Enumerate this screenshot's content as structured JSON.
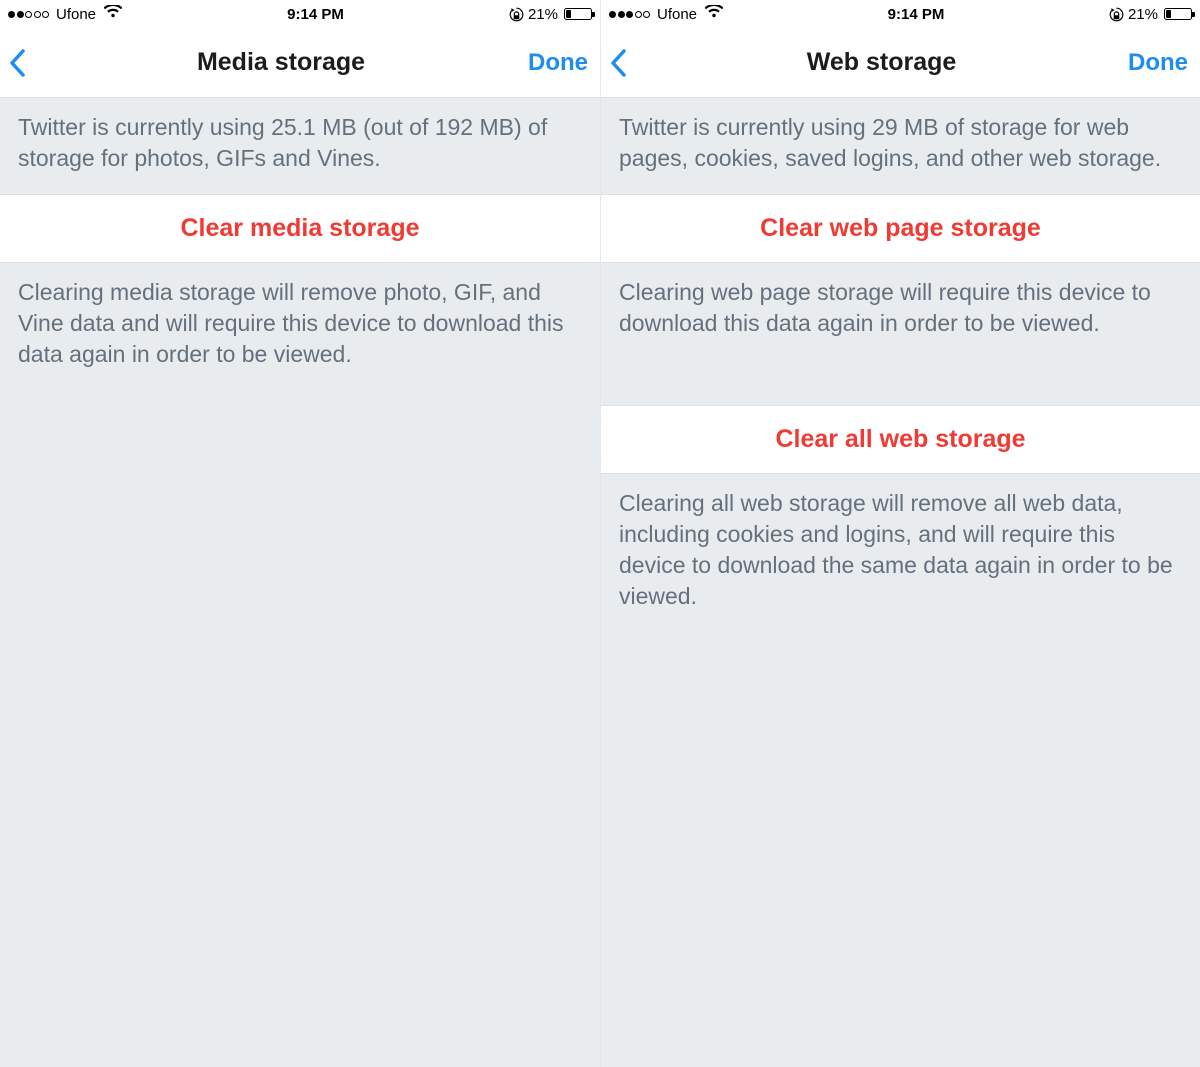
{
  "statusbar": {
    "left": {
      "signal_filled": 2,
      "signal_filled_right": 3,
      "carrier": "Ufone"
    },
    "time": "9:14 PM",
    "battery_pct": "21%"
  },
  "panels": {
    "left": {
      "nav": {
        "title": "Media storage",
        "done": "Done"
      },
      "desc1": "Twitter is currently using 25.1 MB (out of 192 MB) of storage for photos, GIFs and Vines.",
      "btn1": "Clear media storage",
      "footer1": "Clearing media storage will remove photo, GIF, and Vine data and will require this device to download this data again in order to be viewed."
    },
    "right": {
      "nav": {
        "title": "Web storage",
        "done": "Done"
      },
      "desc1": "Twitter is currently using 29 MB of storage for web pages, cookies, saved logins, and other web storage.",
      "btn1": "Clear web page storage",
      "footer1": "Clearing web page storage will require this device to download this data again in order to be viewed.",
      "btn2": "Clear all web storage",
      "footer2": "Clearing all web storage will remove all web data, including cookies and logins, and will require this device to download the same data again in order to be viewed."
    }
  }
}
